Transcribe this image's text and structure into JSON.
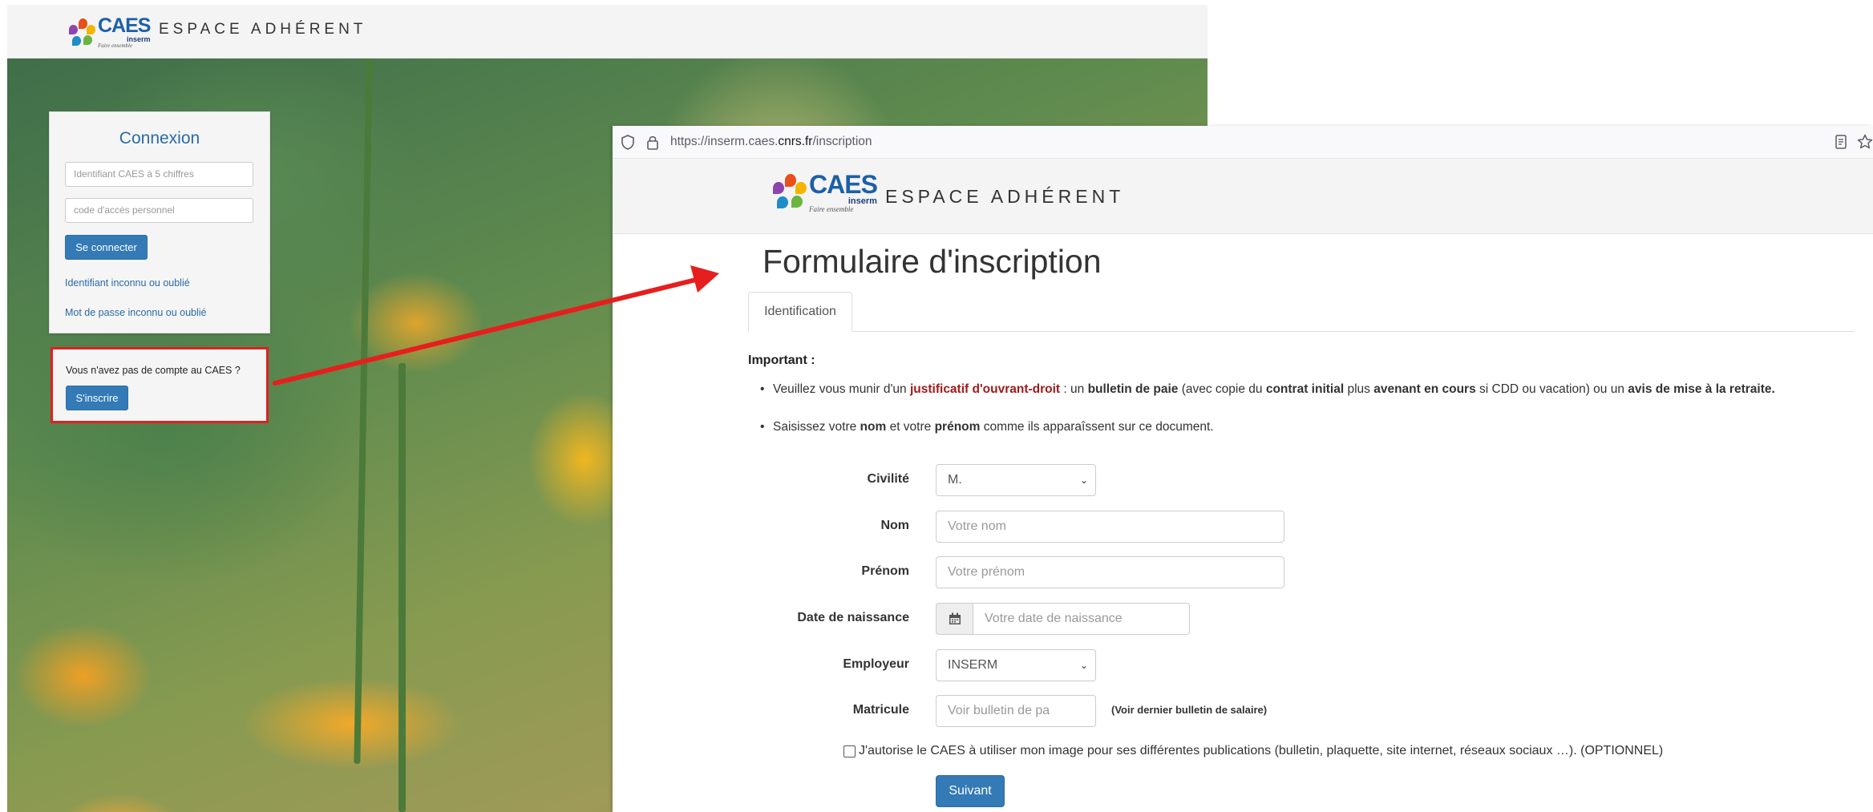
{
  "colors": {
    "primary_button": "#337ab7",
    "link": "#2a6aa8",
    "highlight_border": "#e02020",
    "warning_text": "#a11a1a",
    "arrow": "#e61e1e"
  },
  "brand": {
    "logo_word": "CAES",
    "logo_sub": "inserm",
    "logo_tagline": "Faire ensemble",
    "espace_title": "ESPACE ADHÉRENT"
  },
  "login_page": {
    "panel_title": "Connexion",
    "identifiant_placeholder": "Identifiant CAES à 5 chiffres",
    "code_placeholder": "code d'accès personnel",
    "connect_button": "Se connecter",
    "forgot_id_link": "Identifiant inconnu ou oublié",
    "forgot_pwd_link": "Mot de passe inconnu ou oublié",
    "no_account_text": "Vous n'avez pas de compte au CAES ?",
    "signup_button": "S'inscrire"
  },
  "browser": {
    "url_prefix": "https://inserm.caes.",
    "url_domain": "cnrs.fr",
    "url_path": "/inscription",
    "icons": [
      "shield-icon",
      "lock-icon",
      "reader-view-icon",
      "star-icon"
    ]
  },
  "form_page": {
    "title": "Formulaire d'inscription",
    "tab_label": "Identification",
    "important_label": "Important :",
    "bullet1": {
      "t1": "Veuillez vous munir d'un ",
      "b1": "justificatif d'ouvrant-droit",
      "t2": " : un ",
      "b2": "bulletin de paie",
      "t3": " (avec copie du ",
      "b3": "contrat initial",
      "t4": " plus ",
      "b4": "avenant en cours",
      "t5": " si CDD ou vacation) ou un ",
      "b5": "avis de mise à la retraite."
    },
    "bullet2": {
      "t1": "Saisissez votre ",
      "b1": "nom",
      "t2": " et votre ",
      "b2": "prénom",
      "t3": " comme ils apparaîssent sur ce document."
    },
    "fields": {
      "civilite": {
        "label": "Civilité",
        "value": "M."
      },
      "nom": {
        "label": "Nom",
        "placeholder": "Votre nom"
      },
      "prenom": {
        "label": "Prénom",
        "placeholder": "Votre prénom"
      },
      "date": {
        "label": "Date de naissance",
        "placeholder": "Votre date de naissance"
      },
      "employeur": {
        "label": "Employeur",
        "value": "INSERM"
      },
      "matricule": {
        "label": "Matricule",
        "placeholder": "Voir bulletin de pa",
        "hint": "(Voir dernier bulletin de salaire)"
      }
    },
    "consent_text": "J'autorise le CAES à utiliser mon image pour ses différentes publications (bulletin, plaquette, site internet, réseaux sociaux …). (OPTIONNEL)",
    "next_button": "Suivant"
  }
}
